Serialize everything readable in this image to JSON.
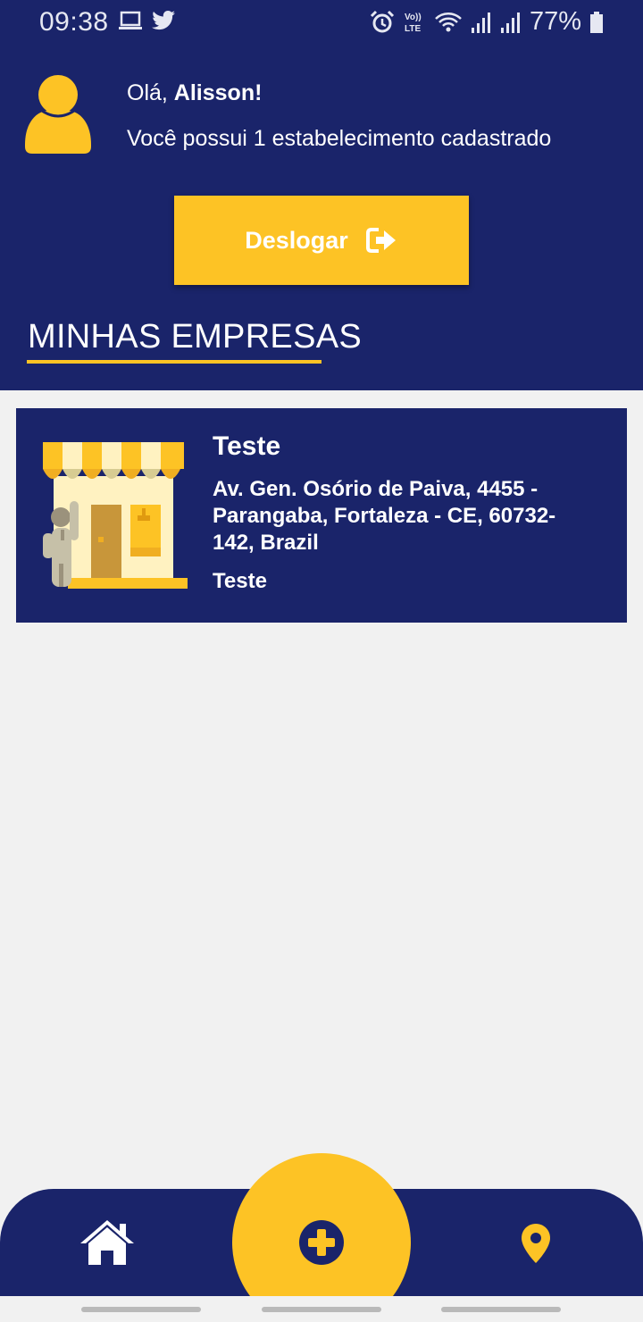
{
  "status_bar": {
    "time": "09:38",
    "battery_percent": "77%",
    "icons": [
      "laptop-icon",
      "twitter-icon",
      "alarm-icon",
      "volte-icon",
      "wifi-icon",
      "signal-icon",
      "signal-icon",
      "battery-icon"
    ]
  },
  "header": {
    "greeting_prefix": "Olá, ",
    "user_name": "Alisson!",
    "subtitle": "Você possui 1 estabelecimento cadastrado",
    "logout_label": "Deslogar",
    "logout_icon": "sign-out-icon",
    "section_title": "MINHAS EMPRESAS"
  },
  "companies": [
    {
      "name": "Teste",
      "address": "Av. Gen. Osório de Paiva, 4455 - Parangaba, Fortaleza - CE, 60732-142, Brazil",
      "description": "Teste",
      "image": "store-illustration"
    }
  ],
  "bottom_nav": {
    "items": [
      "home-icon",
      "add-circle-icon",
      "location-pin-icon"
    ]
  },
  "colors": {
    "primary": "#1a246a",
    "accent": "#fdc325",
    "background": "#f1f1f1"
  }
}
